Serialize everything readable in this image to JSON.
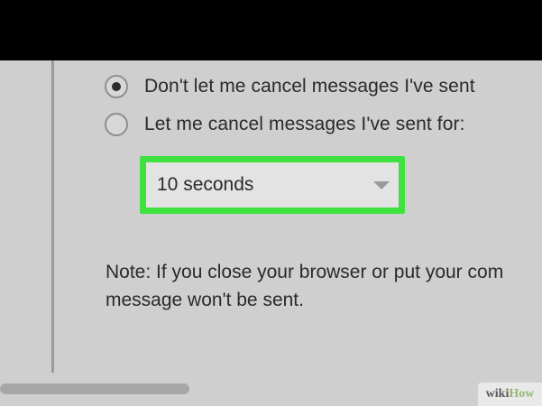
{
  "options": {
    "dont_cancel_label": "Don't let me cancel messages I've sent",
    "dont_cancel_selected": true,
    "cancel_for_label": "Let me cancel messages I've sent for:",
    "cancel_for_selected": false
  },
  "dropdown": {
    "selected_value": "10 seconds"
  },
  "note": {
    "line1": "Note: If you close your browser or put your com",
    "line2": "message won't be sent."
  },
  "watermark": {
    "wiki": "wiki",
    "how": "How"
  },
  "colors": {
    "highlight": "#3fe13f",
    "panel": "#cfcfcf",
    "text": "#2a2a2a"
  },
  "icons": {
    "dropdown_arrow": "chevron-down-icon"
  }
}
